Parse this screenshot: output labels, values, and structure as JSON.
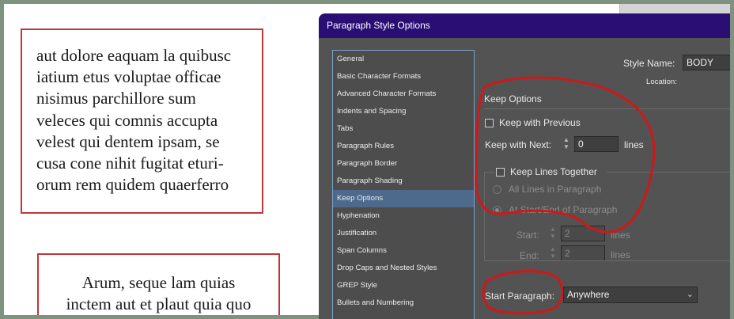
{
  "document": {
    "frame1_lines": [
      "aut dolore eaquam la quibusc",
      "iatium etus voluptae officae",
      "nisimus parchillore sum",
      "veleces qui comnis accupta",
      "velest qui dentem ipsam, se",
      "cusa cone nihit fugitat eturi-",
      "orum rem quidem quaerferro"
    ],
    "frame2_lines": [
      "Arum, seque lam quias",
      "inctem aut et plaut quia quo"
    ]
  },
  "dialog": {
    "title": "Paragraph Style Options",
    "style_name_label": "Style Name:",
    "style_name_value": "BODY",
    "location_label": "Location:",
    "nav_items": [
      "General",
      "Basic Character Formats",
      "Advanced Character Formats",
      "Indents and Spacing",
      "Tabs",
      "Paragraph Rules",
      "Paragraph Border",
      "Paragraph Shading",
      "Keep Options",
      "Hyphenation",
      "Justification",
      "Span Columns",
      "Drop Caps and Nested Styles",
      "GREP Style",
      "Bullets and Numbering"
    ],
    "selected_nav": "Keep Options",
    "section_title": "Keep Options",
    "keep_with_previous_label": "Keep with Previous",
    "keep_with_previous_checked": false,
    "keep_with_next_label": "Keep with Next:",
    "keep_with_next_value": "0",
    "keep_with_next_unit": "lines",
    "keep_lines_together_label": "Keep Lines Together",
    "keep_lines_together_checked": false,
    "all_lines_label": "All Lines in Paragraph",
    "start_end_label": "At Start/End of Paragraph",
    "start_label": "Start:",
    "start_value": "2",
    "start_unit": "lines",
    "end_label": "End:",
    "end_value": "2",
    "end_unit": "lines",
    "start_paragraph_label": "Start Paragraph:",
    "start_paragraph_value": "Anywhere"
  },
  "colors": {
    "frame_border": "#c0363a",
    "titlebar": "#2a0e73",
    "dialog_bg": "#535353",
    "selected_nav": "#4d6a8c",
    "annotation": "#d01818"
  }
}
